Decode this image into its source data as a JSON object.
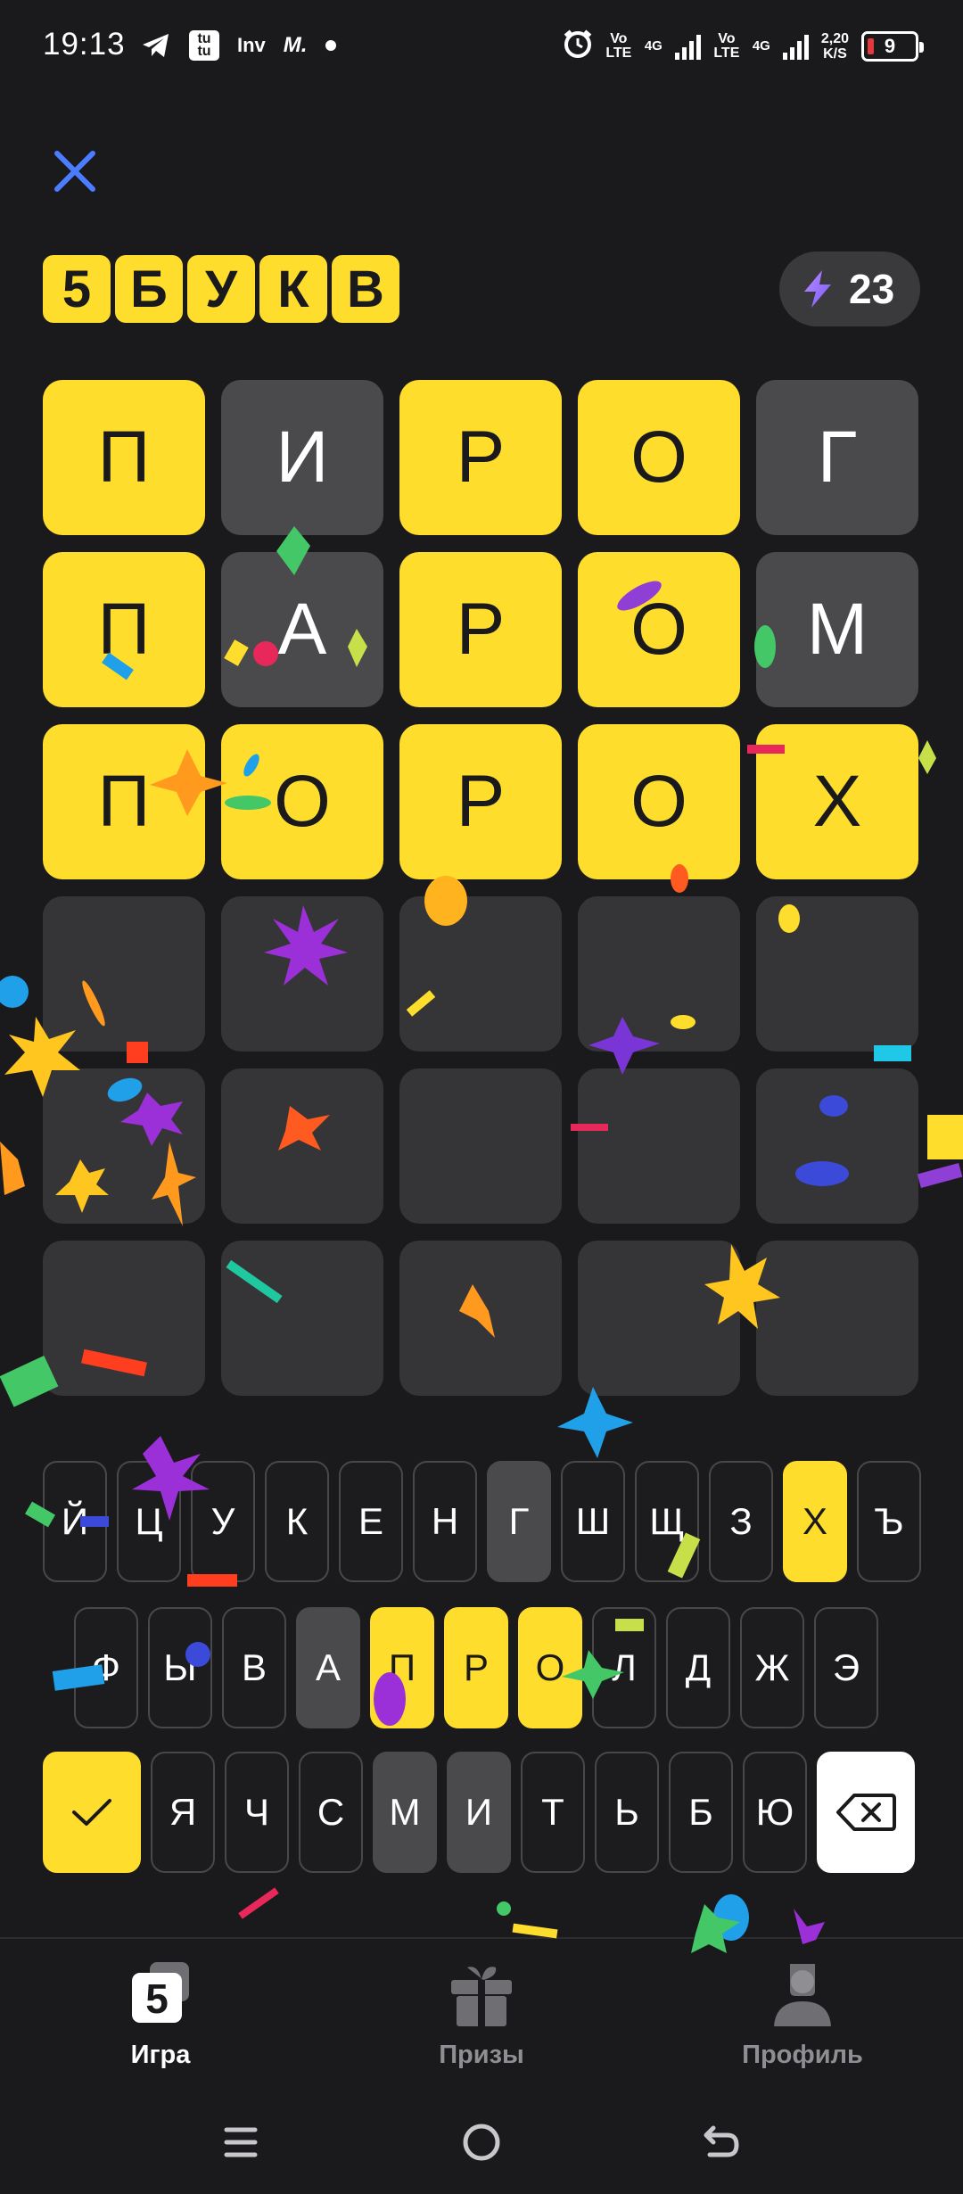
{
  "status_bar": {
    "time": "19:13",
    "left_icons": [
      "telegram-icon",
      "tutu-icon",
      "inv-icon",
      "m-icon",
      "dot-icon"
    ],
    "tutu_text": "tu tu",
    "inv_text": "Inv",
    "m_text": "M.",
    "volte1": "Vo LTE",
    "net1": "4G",
    "volte2": "Vo LTE",
    "net2": "4G",
    "speed_value": "2,20",
    "speed_unit": "K/S",
    "battery": "9"
  },
  "header": {
    "logo_letters": [
      "5",
      "Б",
      "У",
      "К",
      "В"
    ],
    "energy_value": "23",
    "accent_color": "#ffdd2d"
  },
  "board": {
    "rows": [
      [
        {
          "l": "П",
          "s": "present"
        },
        {
          "l": "И",
          "s": "absent"
        },
        {
          "l": "Р",
          "s": "present"
        },
        {
          "l": "О",
          "s": "present"
        },
        {
          "l": "Г",
          "s": "absent"
        }
      ],
      [
        {
          "l": "П",
          "s": "present"
        },
        {
          "l": "А",
          "s": "absent"
        },
        {
          "l": "Р",
          "s": "present"
        },
        {
          "l": "О",
          "s": "present"
        },
        {
          "l": "М",
          "s": "absent"
        }
      ],
      [
        {
          "l": "П",
          "s": "present"
        },
        {
          "l": "О",
          "s": "present"
        },
        {
          "l": "Р",
          "s": "present"
        },
        {
          "l": "О",
          "s": "present"
        },
        {
          "l": "Х",
          "s": "present"
        }
      ],
      [
        {
          "l": "",
          "s": "empty"
        },
        {
          "l": "",
          "s": "empty"
        },
        {
          "l": "",
          "s": "empty"
        },
        {
          "l": "",
          "s": "empty"
        },
        {
          "l": "",
          "s": "empty"
        }
      ],
      [
        {
          "l": "",
          "s": "empty"
        },
        {
          "l": "",
          "s": "empty"
        },
        {
          "l": "",
          "s": "empty"
        },
        {
          "l": "",
          "s": "empty"
        },
        {
          "l": "",
          "s": "empty"
        }
      ],
      [
        {
          "l": "",
          "s": "empty"
        },
        {
          "l": "",
          "s": "empty"
        },
        {
          "l": "",
          "s": "empty"
        },
        {
          "l": "",
          "s": "empty"
        },
        {
          "l": "",
          "s": "empty"
        }
      ]
    ]
  },
  "keyboard": {
    "row1": [
      {
        "k": "Й",
        "s": ""
      },
      {
        "k": "Ц",
        "s": ""
      },
      {
        "k": "У",
        "s": ""
      },
      {
        "k": "К",
        "s": ""
      },
      {
        "k": "Е",
        "s": ""
      },
      {
        "k": "Н",
        "s": ""
      },
      {
        "k": "Г",
        "s": "absent"
      },
      {
        "k": "Ш",
        "s": ""
      },
      {
        "k": "Щ",
        "s": ""
      },
      {
        "k": "З",
        "s": ""
      },
      {
        "k": "Х",
        "s": "present"
      },
      {
        "k": "Ъ",
        "s": ""
      }
    ],
    "row2": [
      {
        "k": "Ф",
        "s": ""
      },
      {
        "k": "Ы",
        "s": ""
      },
      {
        "k": "В",
        "s": ""
      },
      {
        "k": "А",
        "s": "absent"
      },
      {
        "k": "П",
        "s": "present"
      },
      {
        "k": "Р",
        "s": "present"
      },
      {
        "k": "О",
        "s": "present"
      },
      {
        "k": "Л",
        "s": ""
      },
      {
        "k": "Д",
        "s": ""
      },
      {
        "k": "Ж",
        "s": ""
      },
      {
        "k": "Э",
        "s": ""
      }
    ],
    "row3": [
      {
        "k": "Я",
        "s": ""
      },
      {
        "k": "Ч",
        "s": ""
      },
      {
        "k": "С",
        "s": ""
      },
      {
        "k": "М",
        "s": "absent"
      },
      {
        "k": "И",
        "s": "absent"
      },
      {
        "k": "Т",
        "s": ""
      },
      {
        "k": "Ь",
        "s": ""
      },
      {
        "k": "Б",
        "s": ""
      },
      {
        "k": "Ю",
        "s": ""
      }
    ],
    "enter_icon": "checkmark-icon",
    "backspace_icon": "backspace-icon"
  },
  "bottom_nav": {
    "items": [
      {
        "label": "Игра",
        "icon": "game-icon",
        "active": true
      },
      {
        "label": "Призы",
        "icon": "gift-icon",
        "active": false
      },
      {
        "label": "Профиль",
        "icon": "profile-icon",
        "active": false
      }
    ]
  },
  "system_nav": [
    "menu-icon",
    "home-icon",
    "back-icon"
  ]
}
